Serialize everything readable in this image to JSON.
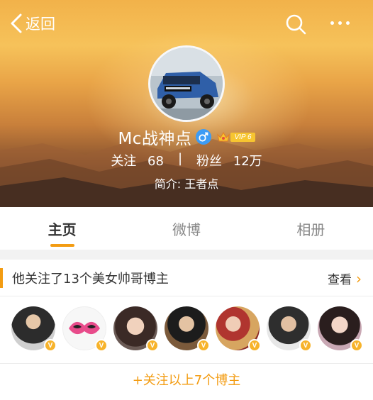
{
  "nav": {
    "back_label": "返回",
    "back_icon": "chevron-left-icon",
    "search_icon": "search-icon",
    "more_icon": "more-icon"
  },
  "profile": {
    "name": "Mc战神点",
    "gender_symbol": "♂",
    "vip_label": "VIP 6",
    "stats": {
      "following_label": "关注",
      "following_value": "68",
      "separator": "|",
      "followers_label": "粉丝",
      "followers_value": "12万"
    },
    "bio": "简介: 王者点"
  },
  "tabs": [
    {
      "label": "主页",
      "active": true
    },
    {
      "label": "微博",
      "active": false
    },
    {
      "label": "相册",
      "active": false
    }
  ],
  "recommend": {
    "title": "他关注了13个美女帅哥博主",
    "more_label": "查看",
    "more_icon": "›",
    "badge_text": "V",
    "follow_all_label": "+关注以上7个博主"
  },
  "colors": {
    "accent": "#f39c12",
    "badge": "#f7b32b",
    "gender": "#3d9cf5"
  }
}
